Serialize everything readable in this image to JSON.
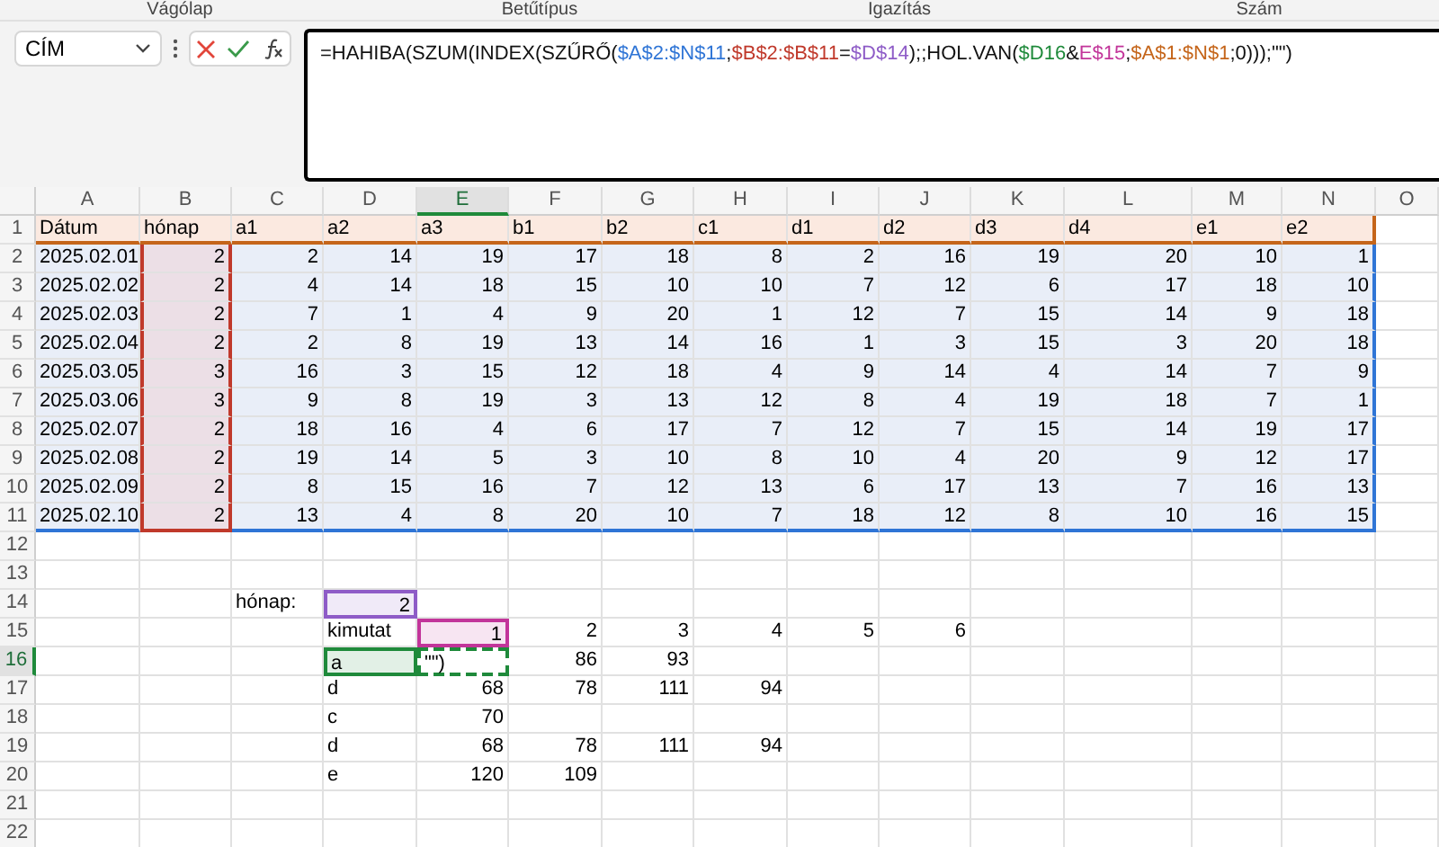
{
  "ribbon_groups": [
    "Vágólap",
    "Betűtípus",
    "Igazítás",
    "Szám"
  ],
  "name_box": {
    "value": "CÍM"
  },
  "formula": [
    {
      "text": "=HAHIBA(SZUM(INDEX(SZŰRŐ(",
      "color": "#111111"
    },
    {
      "text": "$A$2:$N$11",
      "color": "#2f75d6"
    },
    {
      "text": ";",
      "color": "#111111"
    },
    {
      "text": "$B$2:$B$11",
      "color": "#c0392b"
    },
    {
      "text": "=",
      "color": "#111111"
    },
    {
      "text": "$D$14",
      "color": "#8e5cc7"
    },
    {
      "text": ");;HOL.VAN(",
      "color": "#111111"
    },
    {
      "text": "$D16",
      "color": "#1f8a3b"
    },
    {
      "text": "&",
      "color": "#111111"
    },
    {
      "text": "E$15",
      "color": "#c2359a"
    },
    {
      "text": ";",
      "color": "#111111"
    },
    {
      "text": "$A$1:$N$1",
      "color": "#c5651a"
    },
    {
      "text": ";0)));\"\")",
      "color": "#111111"
    }
  ],
  "columns": [
    {
      "label": "A",
      "selected": false
    },
    {
      "label": "B",
      "selected": false
    },
    {
      "label": "C",
      "selected": false
    },
    {
      "label": "D",
      "selected": false
    },
    {
      "label": "E",
      "selected": true
    },
    {
      "label": "F",
      "selected": false
    },
    {
      "label": "G",
      "selected": false
    },
    {
      "label": "H",
      "selected": false
    },
    {
      "label": "I",
      "selected": false
    },
    {
      "label": "J",
      "selected": false
    },
    {
      "label": "K",
      "selected": false
    },
    {
      "label": "L",
      "selected": false
    },
    {
      "label": "M",
      "selected": false
    },
    {
      "label": "N",
      "selected": false
    },
    {
      "label": "O",
      "selected": false
    }
  ],
  "table": {
    "header": [
      "Dátum",
      "hónap",
      "a1",
      "a2",
      "a3",
      "b1",
      "b2",
      "c1",
      "d1",
      "d2",
      "d3",
      "d4",
      "e1",
      "e2"
    ],
    "rows": [
      [
        "2025.02.01",
        "2",
        "2",
        "14",
        "19",
        "17",
        "18",
        "8",
        "2",
        "16",
        "19",
        "20",
        "10",
        "1"
      ],
      [
        "2025.02.02",
        "2",
        "4",
        "14",
        "18",
        "15",
        "10",
        "10",
        "7",
        "12",
        "6",
        "17",
        "18",
        "10"
      ],
      [
        "2025.02.03",
        "2",
        "7",
        "1",
        "4",
        "9",
        "20",
        "1",
        "12",
        "7",
        "15",
        "14",
        "9",
        "18"
      ],
      [
        "2025.02.04",
        "2",
        "2",
        "8",
        "19",
        "13",
        "14",
        "16",
        "1",
        "3",
        "15",
        "3",
        "20",
        "18"
      ],
      [
        "2025.03.05",
        "3",
        "16",
        "3",
        "15",
        "12",
        "18",
        "4",
        "9",
        "14",
        "4",
        "14",
        "7",
        "9"
      ],
      [
        "2025.03.06",
        "3",
        "9",
        "8",
        "19",
        "3",
        "13",
        "12",
        "8",
        "4",
        "19",
        "18",
        "7",
        "1"
      ],
      [
        "2025.02.07",
        "2",
        "18",
        "16",
        "4",
        "6",
        "17",
        "7",
        "12",
        "7",
        "15",
        "14",
        "19",
        "17"
      ],
      [
        "2025.02.08",
        "2",
        "19",
        "14",
        "5",
        "3",
        "10",
        "8",
        "10",
        "4",
        "20",
        "9",
        "12",
        "17"
      ],
      [
        "2025.02.09",
        "2",
        "8",
        "15",
        "16",
        "7",
        "12",
        "13",
        "6",
        "17",
        "13",
        "7",
        "16",
        "13"
      ],
      [
        "2025.02.10",
        "2",
        "13",
        "4",
        "8",
        "20",
        "10",
        "7",
        "18",
        "12",
        "8",
        "10",
        "16",
        "15"
      ]
    ]
  },
  "row_numbers": [
    {
      "number": "1",
      "selected": false
    },
    {
      "number": "2",
      "selected": false
    },
    {
      "number": "3",
      "selected": false
    },
    {
      "number": "4",
      "selected": false
    },
    {
      "number": "5",
      "selected": false
    },
    {
      "number": "6",
      "selected": false
    },
    {
      "number": "7",
      "selected": false
    },
    {
      "number": "8",
      "selected": false
    },
    {
      "number": "9",
      "selected": false
    },
    {
      "number": "10",
      "selected": false
    },
    {
      "number": "11",
      "selected": false
    },
    {
      "number": "12",
      "selected": false
    },
    {
      "number": "13",
      "selected": false
    },
    {
      "number": "14",
      "selected": false
    },
    {
      "number": "15",
      "selected": false
    },
    {
      "number": "16",
      "selected": true
    },
    {
      "number": "17",
      "selected": false
    },
    {
      "number": "18",
      "selected": false
    },
    {
      "number": "19",
      "selected": false
    },
    {
      "number": "20",
      "selected": false
    },
    {
      "number": "21",
      "selected": false
    },
    {
      "number": "22",
      "selected": false
    }
  ],
  "report_rows": [
    [],
    [],
    [
      null,
      null,
      {
        "text": "hónap:",
        "kind": "text"
      },
      {
        "text": "2",
        "kind": "number",
        "color": "#8e5cc7"
      }
    ],
    [
      null,
      null,
      null,
      {
        "text": "kimutat",
        "kind": "text"
      },
      {
        "text": "1",
        "kind": "number",
        "color": "#c2359a"
      },
      {
        "text": "2",
        "kind": "number"
      },
      {
        "text": "3",
        "kind": "number"
      },
      {
        "text": "4",
        "kind": "number"
      },
      {
        "text": "5",
        "kind": "number"
      },
      {
        "text": "6",
        "kind": "number"
      }
    ],
    [
      null,
      null,
      null,
      {
        "text": "a",
        "kind": "text",
        "color": "#1f8a3b"
      },
      {
        "text": "\"\")",
        "kind": "editing"
      },
      {
        "text": "86",
        "kind": "number"
      },
      {
        "text": "93",
        "kind": "number"
      }
    ],
    [
      null,
      null,
      null,
      {
        "text": "d",
        "kind": "text"
      },
      {
        "text": "68",
        "kind": "number"
      },
      {
        "text": "78",
        "kind": "number"
      },
      {
        "text": "111",
        "kind": "number"
      },
      {
        "text": "94",
        "kind": "number"
      }
    ],
    [
      null,
      null,
      null,
      {
        "text": "c",
        "kind": "text"
      },
      {
        "text": "70",
        "kind": "number"
      }
    ],
    [
      null,
      null,
      null,
      {
        "text": "d",
        "kind": "text"
      },
      {
        "text": "68",
        "kind": "number"
      },
      {
        "text": "78",
        "kind": "number"
      },
      {
        "text": "111",
        "kind": "number"
      },
      {
        "text": "94",
        "kind": "number"
      }
    ],
    [
      null,
      null,
      null,
      {
        "text": "e",
        "kind": "text"
      },
      {
        "text": "120",
        "kind": "number"
      },
      {
        "text": "109",
        "kind": "number"
      }
    ],
    [],
    []
  ]
}
